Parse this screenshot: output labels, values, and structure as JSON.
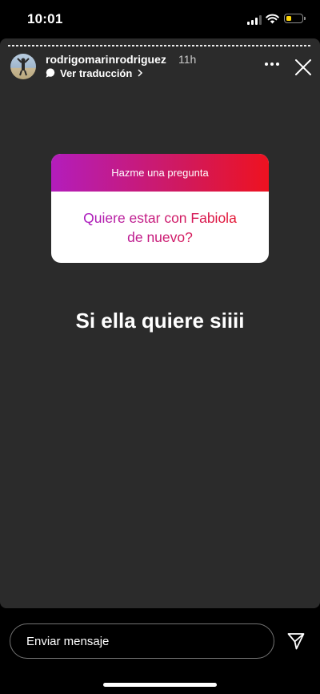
{
  "status_bar": {
    "time": "10:01",
    "signal_icon": "cellular-signal-icon",
    "wifi_icon": "wifi-icon",
    "battery_icon": "battery-icon",
    "battery_level": 0.35,
    "battery_color": "#ffd60a"
  },
  "story": {
    "background_color": "#2b2b2b",
    "user": {
      "username": "rodrigomarinrodriguez",
      "time_ago": "11h"
    },
    "translation": {
      "label": "Ver traducción",
      "icon": "speech-bubble-icon"
    },
    "more_icon": "more-dots-icon",
    "close_icon": "close-icon",
    "question_sticker": {
      "header": "Hazme una pregunta",
      "question": "Quiere estar con Fabiola de nuevo?",
      "gradient_start": "#b31dbc",
      "gradient_end": "#ee1220"
    },
    "answer": "Si ella quiere siiii"
  },
  "reply_bar": {
    "placeholder": "Enviar mensaje",
    "send_icon": "paper-plane-icon"
  }
}
